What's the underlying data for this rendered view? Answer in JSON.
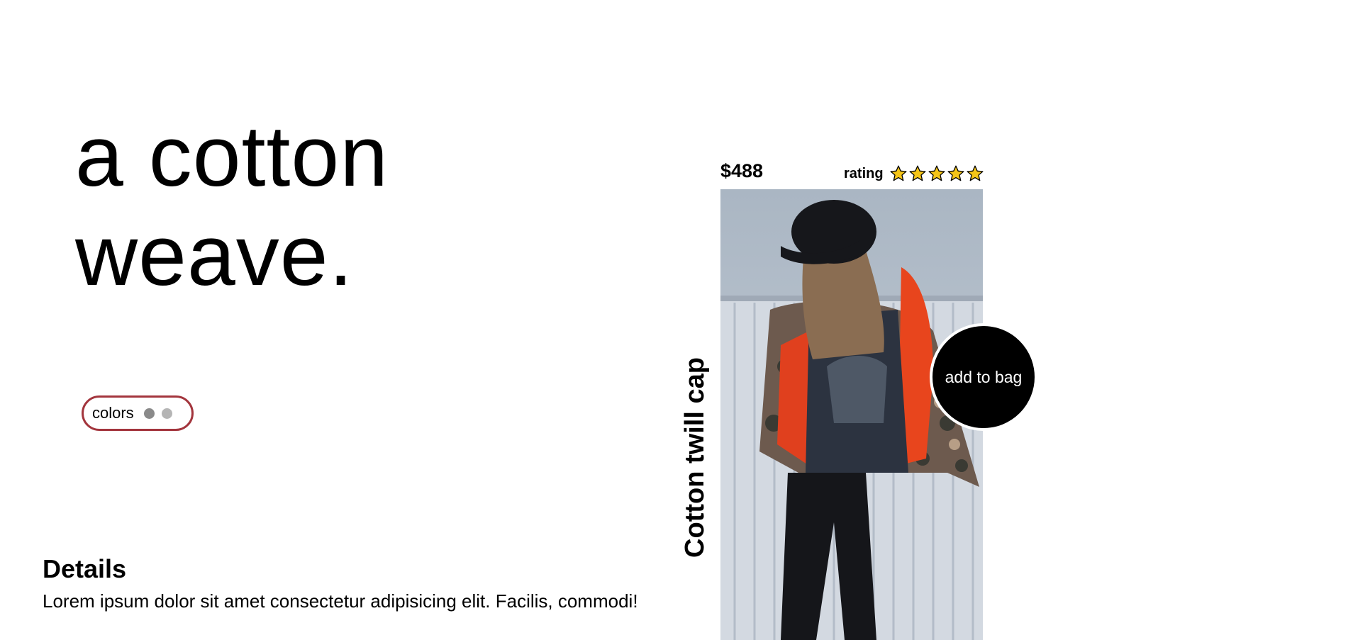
{
  "hero": {
    "line1": "a cotton",
    "line2": "weave."
  },
  "colors_selector": {
    "label": "colors",
    "swatches": [
      "#8a8a8a",
      "#b5b5b5"
    ],
    "accent": "#a3353d"
  },
  "details": {
    "title": "Details",
    "text": "Lorem ipsum dolor sit amet consectetur adipisicing elit. Facilis, commodi!"
  },
  "product": {
    "price": "$488",
    "rating_label": "rating",
    "rating_stars": 5,
    "rating_max": 5,
    "star_color": "#f5c518",
    "name": "Cotton twill cap",
    "add_to_bag": "add to bag",
    "image_icon": "photo-of-person-in-cap-and-camo-jacket"
  }
}
